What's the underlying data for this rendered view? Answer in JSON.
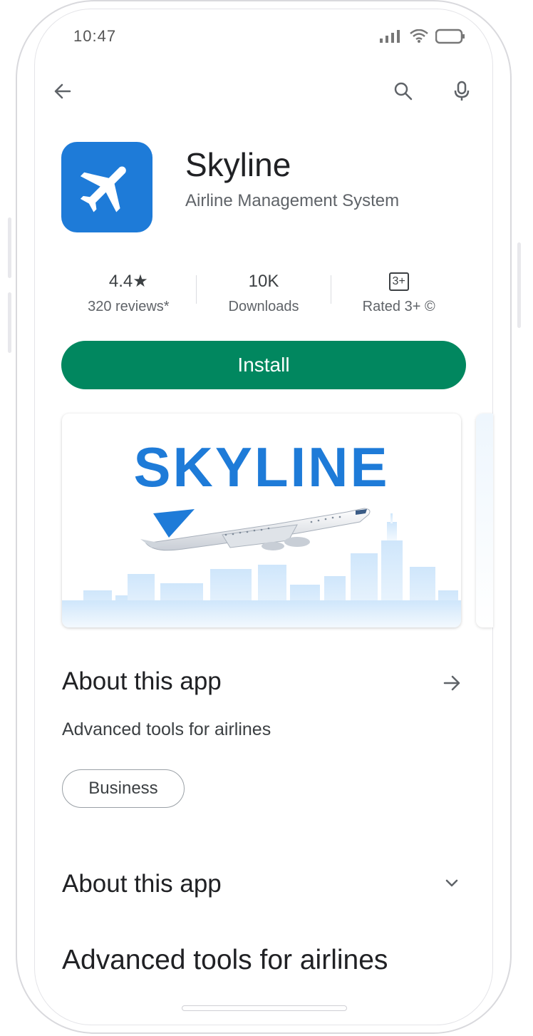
{
  "status_bar": {
    "time": "10:47"
  },
  "app": {
    "name": "Skyline",
    "subtitle": "Airline Management System",
    "icon_color": "#1e7bd8"
  },
  "stats": {
    "rating": "4.4★",
    "reviews": "320 reviews*",
    "downloads": "10K",
    "downloads_label": "Downloads",
    "content_rating_badge": "3+",
    "content_rating_label": "Rated 3+ ©"
  },
  "install": {
    "label": "Install",
    "color": "#01875f"
  },
  "screenshot": {
    "title": "SKYLINE"
  },
  "about": {
    "title": "About this app",
    "description": "Advanced tools for airlines",
    "category_chip": "Business"
  },
  "about_2": {
    "title": "About this app",
    "description": "Advanced tools for airlines"
  }
}
